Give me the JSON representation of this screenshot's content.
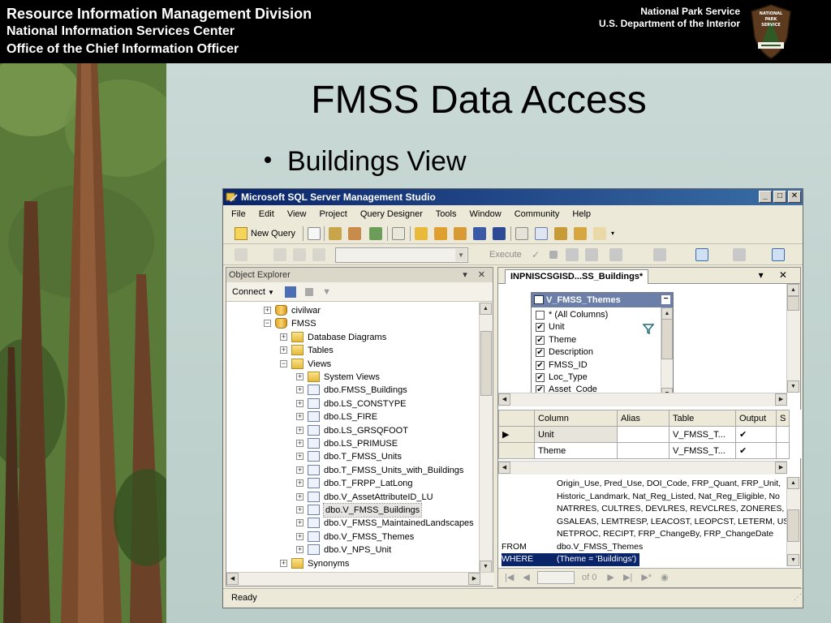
{
  "banner": {
    "left_line1": "Resource Information Management Division",
    "left_line2": "National Information Services Center",
    "left_line3": "Office of the Chief Information Officer",
    "right_line1": "National Park Service",
    "right_line2": "U.S. Department of the Interior",
    "logo_text_1": "NATIONAL",
    "logo_text_2": "PARK",
    "logo_text_3": "SERVICE"
  },
  "slide": {
    "title": "FMSS Data Access",
    "bullet": "Buildings View"
  },
  "window": {
    "title": "Microsoft SQL Server Management Studio",
    "menu": [
      "File",
      "Edit",
      "View",
      "Project",
      "Query Designer",
      "Tools",
      "Window",
      "Community",
      "Help"
    ],
    "new_query": "New Query",
    "execute": "Execute",
    "status": "Ready"
  },
  "object_explorer": {
    "header": "Object Explorer",
    "connect": "Connect",
    "nodes": [
      {
        "label": "civilwar",
        "icon": "database-icon",
        "expander": "+"
      },
      {
        "label": "FMSS",
        "icon": "database-icon",
        "expander": "−"
      },
      {
        "label": "Database Diagrams",
        "icon": "folder-icon",
        "expander": "+"
      },
      {
        "label": "Tables",
        "icon": "folder-icon",
        "expander": "+"
      },
      {
        "label": "Views",
        "icon": "folder-icon",
        "expander": "−"
      },
      {
        "label": "System Views",
        "icon": "folder-icon",
        "expander": "+"
      },
      {
        "label": "dbo.FMSS_Buildings",
        "icon": "view-icon",
        "expander": "+"
      },
      {
        "label": "dbo.LS_CONSTYPE",
        "icon": "view-icon",
        "expander": "+"
      },
      {
        "label": "dbo.LS_FIRE",
        "icon": "view-icon",
        "expander": "+"
      },
      {
        "label": "dbo.LS_GRSQFOOT",
        "icon": "view-icon",
        "expander": "+"
      },
      {
        "label": "dbo.LS_PRIMUSE",
        "icon": "view-icon",
        "expander": "+"
      },
      {
        "label": "dbo.T_FMSS_Units",
        "icon": "view-icon",
        "expander": "+"
      },
      {
        "label": "dbo.T_FMSS_Units_with_Buildings",
        "icon": "view-icon",
        "expander": "+"
      },
      {
        "label": "dbo.T_FRPP_LatLong",
        "icon": "view-icon",
        "expander": "+"
      },
      {
        "label": "dbo.V_AssetAttributeID_LU",
        "icon": "view-icon",
        "expander": "+"
      },
      {
        "label": "dbo.V_FMSS_Buildings",
        "icon": "view-icon",
        "expander": "+",
        "selected": true
      },
      {
        "label": "dbo.V_FMSS_MaintainedLandscapes",
        "icon": "view-icon",
        "expander": "+"
      },
      {
        "label": "dbo.V_FMSS_Themes",
        "icon": "view-icon",
        "expander": "+"
      },
      {
        "label": "dbo.V_NPS_Unit",
        "icon": "view-icon",
        "expander": "+"
      },
      {
        "label": "Synonyms",
        "icon": "folder-icon",
        "expander": "+"
      }
    ]
  },
  "designer": {
    "tab": "INPNISCSGISD...SS_Buildings*",
    "table_box": {
      "title": "V_FMSS_Themes",
      "columns": [
        {
          "label": "* (All Columns)",
          "checked": false
        },
        {
          "label": "Unit",
          "checked": true
        },
        {
          "label": "Theme",
          "checked": true
        },
        {
          "label": "Description",
          "checked": true
        },
        {
          "label": "FMSS_ID",
          "checked": true
        },
        {
          "label": "Loc_Type",
          "checked": true
        },
        {
          "label": "Asset_Code",
          "checked": true
        }
      ]
    },
    "grid": {
      "headers": [
        "Column",
        "Alias",
        "Table",
        "Output",
        "S"
      ],
      "rows": [
        {
          "column": "Unit",
          "alias": "",
          "table": "V_FMSS_T...",
          "output": "✔"
        },
        {
          "column": "Theme",
          "alias": "",
          "table": "V_FMSS_T...",
          "output": "✔"
        }
      ]
    },
    "sql_lines": [
      {
        "kw": "",
        "text": "Origin_Use, Pred_Use, DOI_Code, FRP_Quant, FRP_Unit,"
      },
      {
        "kw": "",
        "text": "Historic_Landmark, Nat_Reg_Listed, Nat_Reg_Eligible, No"
      },
      {
        "kw": "",
        "text": "NATRRES, CULTRES, DEVLRES, REVCLRES, ZONERES, EA"
      },
      {
        "kw": "",
        "text": "GSALEAS, LEMTRESP, LEACOST, LEOPCST, LETERM, USE"
      },
      {
        "kw": "",
        "text": "NETPROC, RECIPT, FRP_ChangeBy, FRP_ChangeDate"
      },
      {
        "kw": "FROM",
        "text": "dbo.V_FMSS_Themes"
      },
      {
        "kw": "WHERE",
        "text": "(Theme = 'Buildings')"
      }
    ],
    "nav_of": "of 0"
  }
}
